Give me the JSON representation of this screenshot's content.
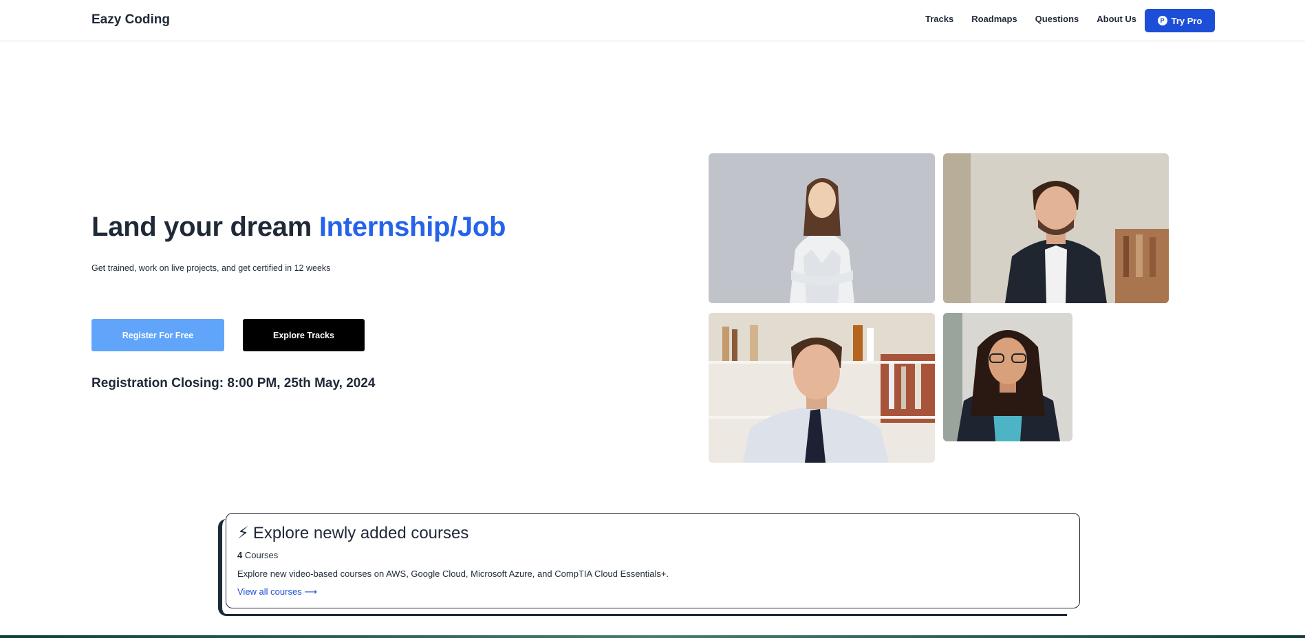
{
  "nav": {
    "brand": "Eazy Coding",
    "links": [
      "Tracks",
      "Roadmaps",
      "Questions",
      "About Us"
    ],
    "cta_label": "Try Pro",
    "cta_icon_letter": "P"
  },
  "hero": {
    "title_prefix": "Land your dream ",
    "title_accent": "Internship/Job",
    "subtitle": "Get trained, work on live projects, and get certified in 12 weeks",
    "register_label": "Register For Free",
    "explore_label": "Explore Tracks",
    "closing_text": "Registration Closing: 8:00 PM, 25th May, 2024"
  },
  "course_card": {
    "title": "Explore newly added courses",
    "count_number": "4",
    "count_label": " Courses",
    "description": "Explore new video-based courses on AWS, Google Cloud, Microsoft Azure, and CompTIA Cloud Essentials+.",
    "link_label": "View all courses"
  },
  "colors": {
    "accent": "#2563eb",
    "try_pro_bg": "#1d4ed8",
    "register_bg": "#60a5fa",
    "explore_bg": "#000000"
  },
  "icons": {
    "card_title_icon": "lightning-bolt-icon",
    "link_icon": "arrow-right-icon",
    "cta_icon": "pro-badge-icon"
  }
}
